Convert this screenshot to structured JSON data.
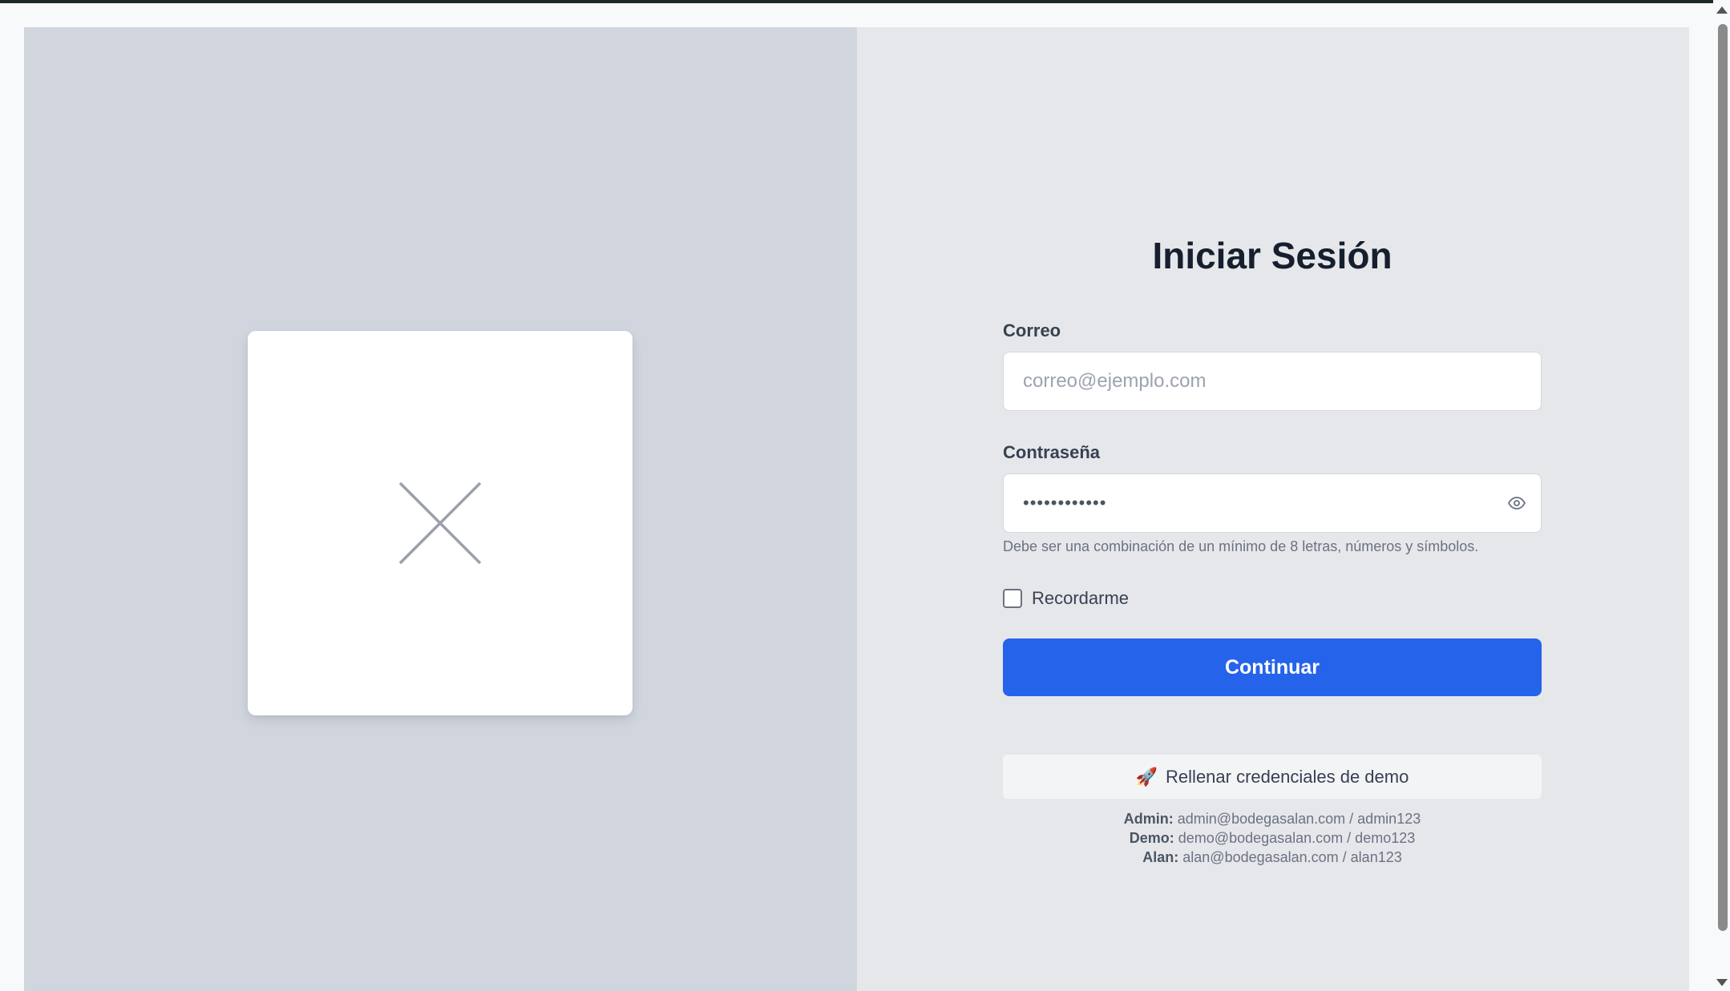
{
  "login": {
    "title": "Iniciar Sesión",
    "email_label": "Correo",
    "email_placeholder": "correo@ejemplo.com",
    "password_label": "Contraseña",
    "password_value": "••••••••••••",
    "password_hint": "Debe ser una combinación de un mínimo de 8 letras, números y símbolos.",
    "remember_label": "Recordarme",
    "remember_checked": false,
    "continue_label": "Continuar",
    "demo_button_icon": "🚀",
    "demo_button_label": "Rellenar credenciales de demo",
    "credentials": [
      {
        "role": "Admin:",
        "value": "admin@bodegasalan.com / admin123"
      },
      {
        "role": "Demo:",
        "value": "demo@bodegasalan.com / demo123"
      },
      {
        "role": "Alan:",
        "value": "alan@bodegasalan.com / alan123"
      }
    ]
  },
  "image_panel": {
    "icon": "broken-image-x-icon"
  },
  "colors": {
    "primary": "#2563eb",
    "left_panel_bg": "#d1d5de",
    "right_panel_bg": "#e5e7eb",
    "title": "#161f2e"
  }
}
